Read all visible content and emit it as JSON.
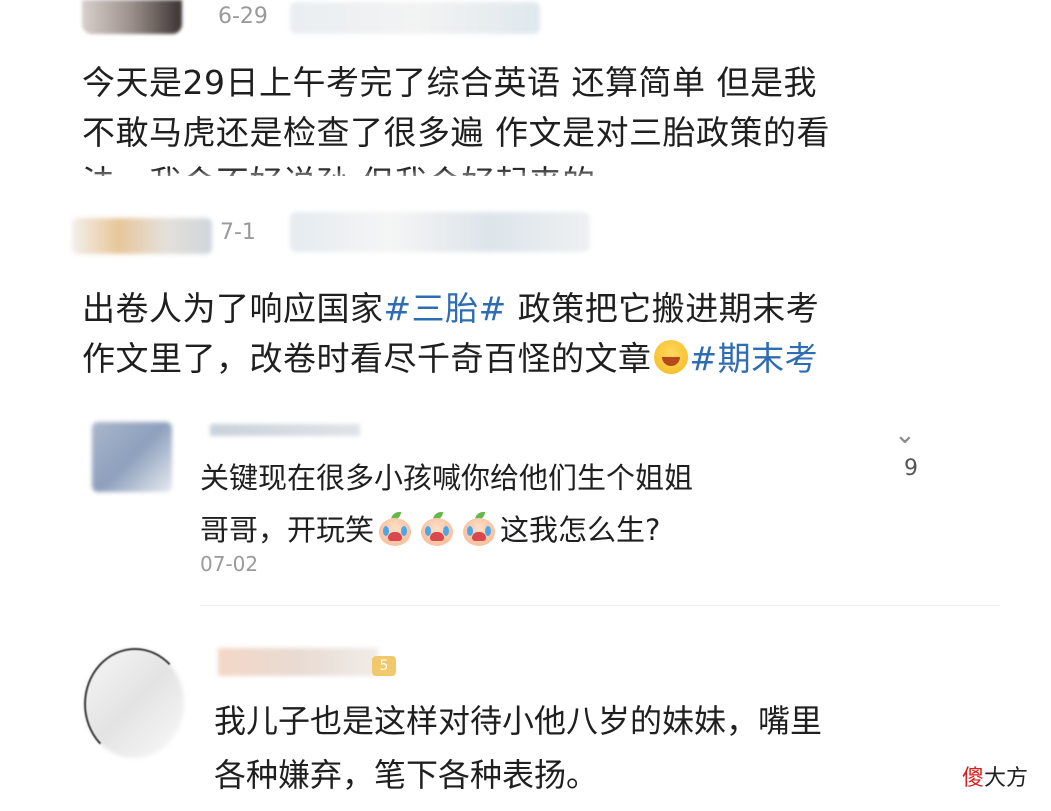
{
  "comment1": {
    "date": "6-29",
    "lines": [
      "今天是29日上午考完了综合英语 还算简单 但是我",
      "不敢马虎还是检查了很多遍 作文是对三胎政策的看",
      "法，我会不好说孙 但我会好起来的"
    ]
  },
  "comment2": {
    "date": "7-1",
    "line1_prefix": "出卷人为了响应国家",
    "hashtag1": "#三胎#",
    "line1_suffix": " 政策把它搬进期末考",
    "line2_text": "作文里了，改卷时看尽千奇百怪的文章",
    "hashtag2": "#期末考",
    "emoji": "laughing-emoji"
  },
  "reply": {
    "line1": "关键现在很多小孩喊你给他们生个姐姐",
    "line2_prefix": "哥哥，开玩笑",
    "line2_suffix": "这我怎么生?",
    "emoji": "crying-baby-emoji",
    "date": "07-02",
    "like_count": "9"
  },
  "comment4": {
    "badge": "5",
    "line1": "我儿子也是这样对待小他八岁的妹妹，嘴里",
    "line2": "各种嫌弃，笔下各种表扬。"
  },
  "watermark": {
    "red_char": "傻",
    "rest": "大方"
  }
}
